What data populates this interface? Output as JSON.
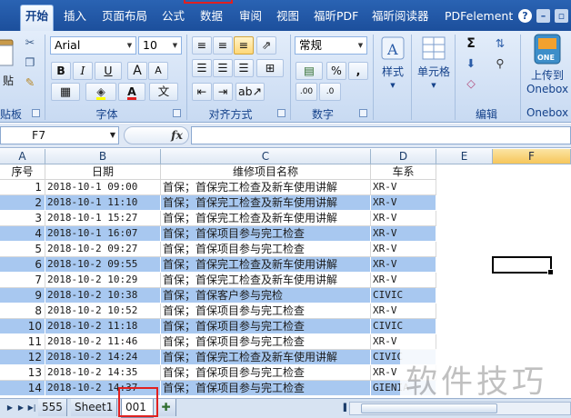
{
  "tabs": [
    {
      "label": "开始",
      "active": true
    },
    {
      "label": "插入"
    },
    {
      "label": "页面布局"
    },
    {
      "label": "公式"
    },
    {
      "label": "数据"
    },
    {
      "label": "审阅"
    },
    {
      "label": "视图"
    },
    {
      "label": "福昕PDF"
    },
    {
      "label": "福昕阅读器"
    },
    {
      "label": "PDFelement"
    }
  ],
  "ribbon": {
    "paste_label": "贴",
    "clipboard_label": "贴板",
    "font_name": "Arial",
    "font_size": "10",
    "font_group_label": "字体",
    "bold": "B",
    "italic": "I",
    "underline": "U",
    "grow_font": "A",
    "shrink_font": "A",
    "wen": "文",
    "align_group_label": "对齐方式",
    "number_format": "常规",
    "percent": "%",
    "comma": ",",
    "dec_inc": ".00",
    "dec_dec": ".0",
    "number_group_label": "数字",
    "style_label": "样式",
    "cell_label": "单元格",
    "sigma": "Σ",
    "editing_label": "编辑",
    "onebox_line1": "上传到",
    "onebox_line2": "Onebox",
    "onebox_group_label": "Onebox",
    "onebox_logo": "ONE"
  },
  "formula_bar": {
    "name_box": "F7",
    "fx": "fx",
    "content": ""
  },
  "columns": [
    "A",
    "B",
    "C",
    "D",
    "E",
    "F"
  ],
  "header_row": {
    "a": "序号",
    "b": "日期",
    "c": "维修项目名称",
    "d": "车系"
  },
  "rows": [
    {
      "n": "1",
      "date": "2018-10-1 09:00",
      "item": "首保；首保完工检查及新车使用讲解",
      "car": "XR-V",
      "blue": false
    },
    {
      "n": "2",
      "date": "2018-10-1 11:10",
      "item": "首保；首保完工检查及新车使用讲解",
      "car": "XR-V",
      "blue": true
    },
    {
      "n": "3",
      "date": "2018-10-1 15:27",
      "item": "首保；首保完工检查及新车使用讲解",
      "car": "XR-V",
      "blue": false
    },
    {
      "n": "4",
      "date": "2018-10-1 16:07",
      "item": "首保；首保项目参与完工检查",
      "car": "XR-V",
      "blue": true
    },
    {
      "n": "5",
      "date": "2018-10-2 09:27",
      "item": "首保；首保项目参与完工检查",
      "car": "XR-V",
      "blue": false
    },
    {
      "n": "6",
      "date": "2018-10-2 09:55",
      "item": "首保；首保完工检查及新车使用讲解",
      "car": "XR-V",
      "blue": true
    },
    {
      "n": "7",
      "date": "2018-10-2 10:29",
      "item": "首保；首保完工检查及新车使用讲解",
      "car": "XR-V",
      "blue": false
    },
    {
      "n": "9",
      "date": "2018-10-2 10:38",
      "item": "首保；首保客户参与完检",
      "car": "CIVIC",
      "blue": true
    },
    {
      "n": "8",
      "date": "2018-10-2 10:52",
      "item": "首保；首保项目参与完工检查",
      "car": "XR-V",
      "blue": false
    },
    {
      "n": "10",
      "date": "2018-10-2 11:18",
      "item": "首保；首保项目参与完工检查",
      "car": "CIVIC",
      "blue": true
    },
    {
      "n": "11",
      "date": "2018-10-2 11:46",
      "item": "首保；首保项目参与完工检查",
      "car": "XR-V",
      "blue": false
    },
    {
      "n": "12",
      "date": "2018-10-2 14:24",
      "item": "首保；首保完工检查及新车使用讲解",
      "car": "CIVIC",
      "blue": true
    },
    {
      "n": "13",
      "date": "2018-10-2 14:35",
      "item": "首保；首保项目参与完工检查",
      "car": "XR-V",
      "blue": false
    },
    {
      "n": "14",
      "date": "2018-10-2 14:37",
      "item": "首保；首保项目参与完工检查",
      "car": "GIENIA",
      "blue": true
    }
  ],
  "sheets": [
    {
      "label": "555"
    },
    {
      "label": "Sheet1"
    },
    {
      "label": "001",
      "active": true
    }
  ],
  "watermark": "软件技巧",
  "colors": {
    "tab_bar": "#2a63b3",
    "ribbon_bg": "#dbe7f7",
    "row_band": "#a8c8f0",
    "selected_col_header": "#f6c65a",
    "highlight_mark": "#e02020"
  }
}
